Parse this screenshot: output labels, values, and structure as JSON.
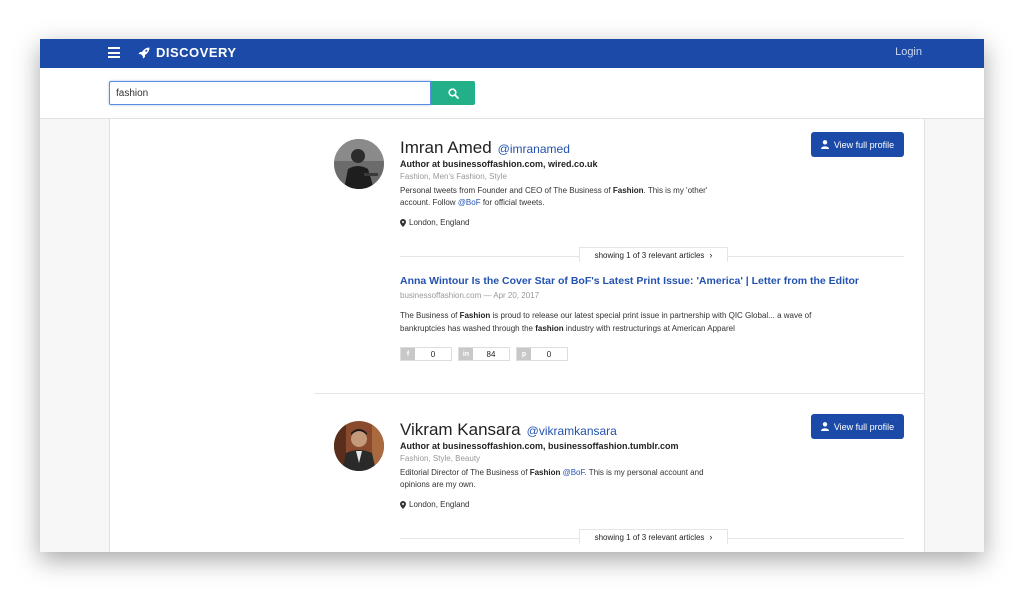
{
  "header": {
    "brand": "DISCOVERY",
    "login": "Login",
    "color": "#1c4aa8"
  },
  "search": {
    "value": "fashion",
    "button_color": "#22b089"
  },
  "results": [
    {
      "name": "Imran Amed",
      "handle": "@imranamed",
      "author_line": "Author at businessoffashion.com, wired.co.uk",
      "tags": "Fashion, Men's Fashion, Style",
      "bio_parts": [
        "Personal tweets from Founder and CEO of The Business of ",
        "Fashion",
        ". This is my 'other'",
        "account. Follow ",
        "@BoF",
        " for official tweets."
      ],
      "location": "London, England",
      "profile_button": "View full profile",
      "showing": "showing 1 of 3 relevant articles",
      "article": {
        "title": "Anna Wintour Is the Cover Star of BoF's Latest Print Issue: 'America' | Letter from the Editor",
        "meta": "businessoffashion.com — Apr 20, 2017",
        "snippet_parts": [
          "The Business of ",
          "Fashion",
          " is proud to release our latest special print issue in partnership with QIC Global... a wave of",
          "bankruptcies has washed through the ",
          "fashion",
          " industry with restructurings at American Apparel"
        ],
        "shares": {
          "facebook": "0",
          "linkedin": "84",
          "pinterest": "0"
        }
      }
    },
    {
      "name": "Vikram Kansara",
      "handle": "@vikramkansara",
      "author_line": "Author at businessoffashion.com, businessoffashion.tumblr.com",
      "tags": "Fashion, Style, Beauty",
      "bio_parts": [
        "Editorial Director of The Business of ",
        "Fashion",
        " ",
        "@BoF",
        ". This is my personal account and",
        "opinions are my own."
      ],
      "location": "London, England",
      "profile_button": "View full profile",
      "showing": "showing 1 of 3 relevant articles"
    }
  ]
}
